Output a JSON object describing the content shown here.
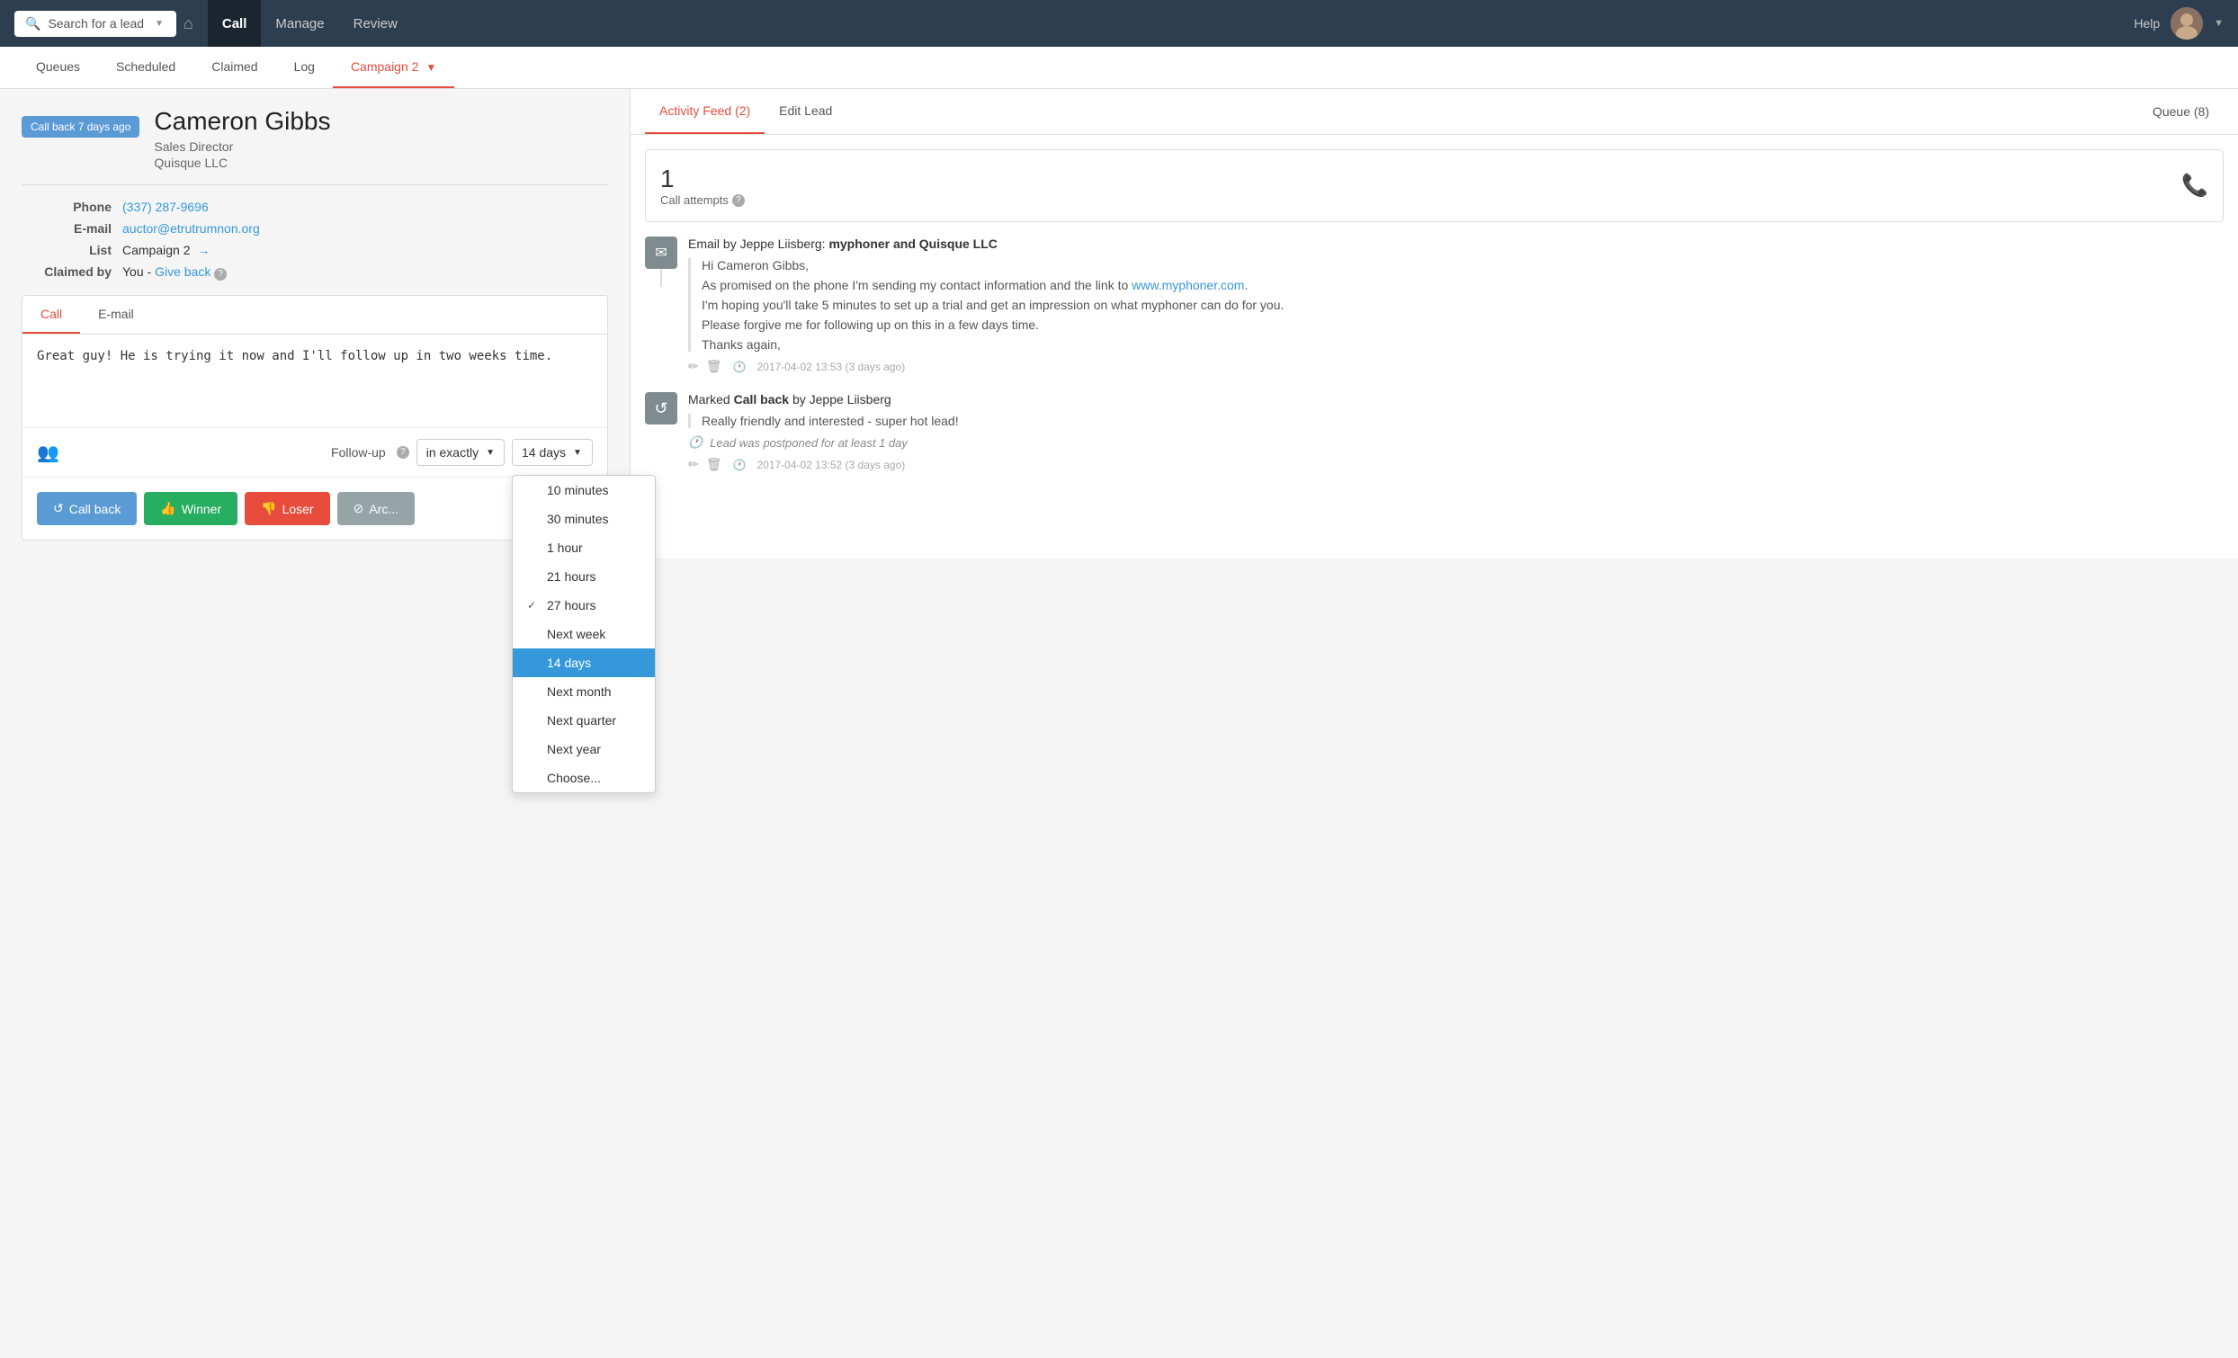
{
  "nav": {
    "search_placeholder": "Search for a lead",
    "home_icon": "⌂",
    "links": [
      "Call",
      "Manage",
      "Review"
    ],
    "active_link": "Call",
    "help_label": "Help",
    "avatar_initials": "👤"
  },
  "sub_nav": {
    "items": [
      "Queues",
      "Scheduled",
      "Claimed",
      "Log"
    ],
    "campaign": "Campaign 2"
  },
  "lead": {
    "badge": "Call back 7 days ago",
    "name": "Cameron Gibbs",
    "title": "Sales Director",
    "company": "Quisque LLC",
    "phone_label": "Phone",
    "phone": "(337) 287-9696",
    "email_label": "E-mail",
    "email": "auctor@etrutrumnon.org",
    "list_label": "List",
    "list": "Campaign 2",
    "claimed_label": "Claimed by",
    "claimed": "You",
    "give_back": "Give back"
  },
  "call_tab": {
    "tab_call": "Call",
    "tab_email": "E-mail",
    "note": "Great guy! He is trying it now and I'll follow up in two weeks time.",
    "follow_up_label": "Follow-up",
    "follow_up_select": "in exactly",
    "follow_up_value": "14 days",
    "dropdown_items": [
      {
        "label": "10 minutes",
        "checked": false,
        "selected": false
      },
      {
        "label": "30 minutes",
        "checked": false,
        "selected": false
      },
      {
        "label": "1 hour",
        "checked": false,
        "selected": false
      },
      {
        "label": "21 hours",
        "checked": false,
        "selected": false
      },
      {
        "label": "27 hours",
        "checked": true,
        "selected": false
      },
      {
        "label": "Next week",
        "checked": false,
        "selected": false
      },
      {
        "label": "14 days",
        "checked": false,
        "selected": true
      },
      {
        "label": "Next month",
        "checked": false,
        "selected": false
      },
      {
        "label": "Next quarter",
        "checked": false,
        "selected": false
      },
      {
        "label": "Next year",
        "checked": false,
        "selected": false
      },
      {
        "label": "Choose...",
        "checked": false,
        "selected": false
      }
    ],
    "btn_callback": "Call back",
    "btn_winner": "Winner",
    "btn_loser": "Loser",
    "btn_archive": "Arc..."
  },
  "right_panel": {
    "tab_feed": "Activity Feed (2)",
    "tab_edit": "Edit Lead",
    "queue": "Queue (8)",
    "stats": {
      "number": "1",
      "label": "Call attempts"
    },
    "timeline": [
      {
        "type": "email",
        "icon": "✉",
        "title_prefix": "Email",
        "title_by": "by Jeppe Liisberg:",
        "title_bold": "myphoner and Quisque LLC",
        "quote_lines": [
          "Hi Cameron Gibbs,",
          "As promised on the phone I'm sending my contact information and the link to www.myphoner.com.",
          "I'm hoping you'll take 5 minutes to set up a trial and get an impression on what myphoner can do for you.",
          "Please forgive me for following up on this in a few days time.",
          "Thanks again,"
        ],
        "link_text": "www.myphoner.com",
        "timestamp": "2017-04-02 13:53 (3 days ago)"
      },
      {
        "type": "callback",
        "icon": "↺",
        "title_prefix": "Marked",
        "title_bold": "Call back",
        "title_suffix": "by Jeppe Liisberg",
        "quote": "Really friendly and interested - super hot lead!",
        "postponed": "Lead was postponed for at least 1 day",
        "timestamp": "2017-04-02 13:52 (3 days ago)"
      }
    ]
  }
}
